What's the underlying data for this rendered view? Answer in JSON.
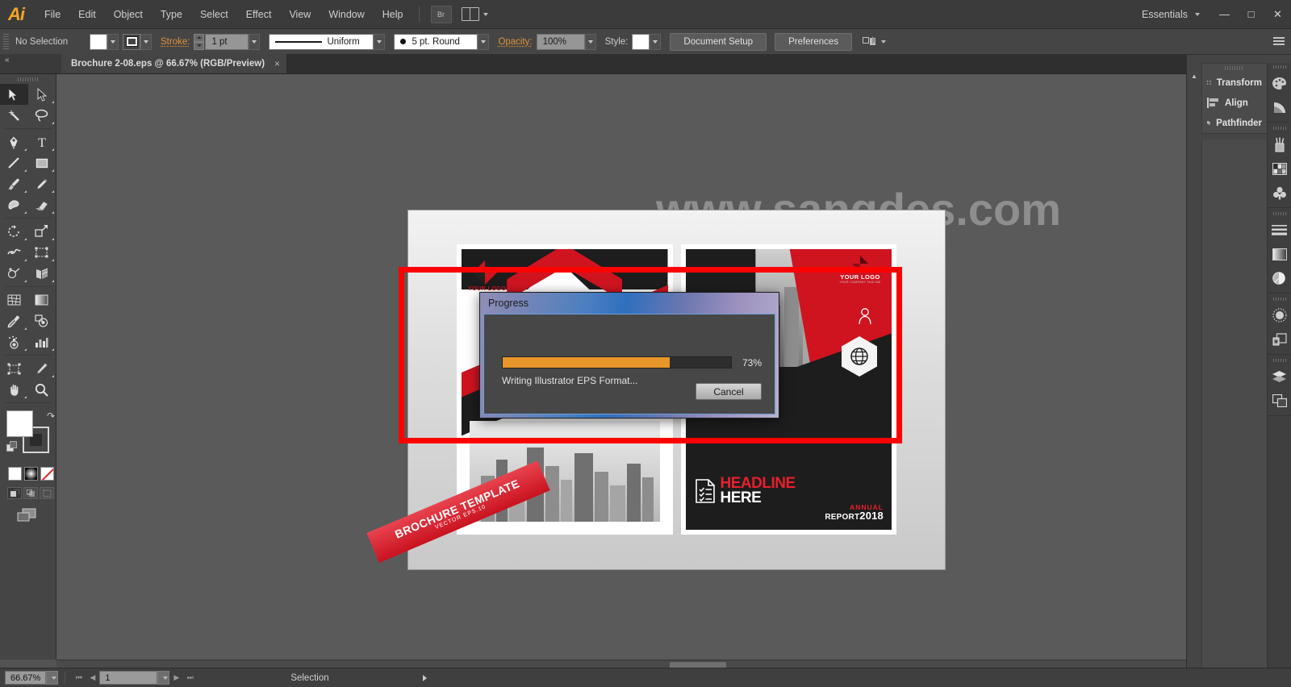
{
  "app": {
    "name": "Adobe Illustrator",
    "logo_text": "Ai"
  },
  "titlebar": {
    "menus": [
      "File",
      "Edit",
      "Object",
      "Type",
      "Select",
      "Effect",
      "View",
      "Window",
      "Help"
    ],
    "bridge_label": "Br",
    "arrange_label": "arrange-documents",
    "workspace": "Essentials",
    "window_buttons": {
      "minimize": "—",
      "maximize": "□",
      "close": "✕"
    }
  },
  "controlbar": {
    "selection_status": "No Selection",
    "fill_label": "Fill",
    "stroke_swatch_label": "Stroke color",
    "stroke_label": "Stroke:",
    "stroke_weight": "1 pt",
    "profile_label": "Uniform",
    "brush_label": "5 pt. Round",
    "opacity_label": "Opacity:",
    "opacity_value": "100%",
    "style_label": "Style:",
    "document_setup": "Document Setup",
    "preferences": "Preferences",
    "align_label": "align-to-selection"
  },
  "tabbar": {
    "document_tab": "Brochure 2-08.eps @ 66.67% (RGB/Preview)",
    "close_glyph": "×",
    "collapse_glyph": "«"
  },
  "toolbar": {
    "tools": [
      {
        "name": "selection-tool",
        "selected": true
      },
      {
        "name": "direct-selection-tool",
        "selected": false
      },
      {
        "name": "magic-wand-tool",
        "selected": false
      },
      {
        "name": "lasso-tool",
        "selected": false
      },
      {
        "name": "pen-tool",
        "selected": false
      },
      {
        "name": "type-tool",
        "selected": false
      },
      {
        "name": "line-segment-tool",
        "selected": false
      },
      {
        "name": "rectangle-tool",
        "selected": false
      },
      {
        "name": "paintbrush-tool",
        "selected": false
      },
      {
        "name": "pencil-tool",
        "selected": false
      },
      {
        "name": "blob-brush-tool",
        "selected": false
      },
      {
        "name": "eraser-tool",
        "selected": false
      },
      {
        "name": "rotate-tool",
        "selected": false
      },
      {
        "name": "scale-tool",
        "selected": false
      },
      {
        "name": "width-tool",
        "selected": false
      },
      {
        "name": "free-transform-tool",
        "selected": false
      },
      {
        "name": "shape-builder-tool",
        "selected": false
      },
      {
        "name": "perspective-grid-tool",
        "selected": false
      },
      {
        "name": "mesh-tool",
        "selected": false
      },
      {
        "name": "gradient-tool",
        "selected": false
      },
      {
        "name": "eyedropper-tool",
        "selected": false
      },
      {
        "name": "blend-tool",
        "selected": false
      },
      {
        "name": "symbol-sprayer-tool",
        "selected": false
      },
      {
        "name": "column-graph-tool",
        "selected": false
      },
      {
        "name": "artboard-tool",
        "selected": false
      },
      {
        "name": "slice-tool",
        "selected": false
      },
      {
        "name": "hand-tool",
        "selected": false
      },
      {
        "name": "zoom-tool",
        "selected": false
      }
    ],
    "fill_color": "#ffffff",
    "stroke_color": "#000000",
    "swap_label": "swap-fill-and-stroke",
    "default_label": "default-fill-and-stroke",
    "paint_modes": [
      "color",
      "gradient",
      "none"
    ],
    "draw_modes": [
      "draw-normal",
      "draw-behind",
      "draw-inside"
    ],
    "screen_mode": "change-screen-mode"
  },
  "canvas": {
    "watermark": "www.sangdes.com",
    "selection_rect_color": "#ff0000"
  },
  "artwork": {
    "left_panel": {
      "logo_text": "YOUR LOGO",
      "ribbon_line1": "BROCHURE TEMPLATE",
      "ribbon_line2": "VECTOR EPS.10"
    },
    "right_panel": {
      "logo_text": "YOUR LOGO",
      "logo_tagline": "YOUR COMPANY TAGLINE",
      "headline_line1": "HEADLINE",
      "headline_line2": "HERE",
      "annual_label": "ANNUAL",
      "report_label": "REPORT",
      "report_year": "2018"
    }
  },
  "dialog": {
    "title": "Progress",
    "progress_percent": "73%",
    "progress_value": 73,
    "message": "Writing Illustrator EPS Format...",
    "cancel_label": "Cancel",
    "bar_color": "#e8962b"
  },
  "right_panels": {
    "items": [
      {
        "label": "Transform",
        "icon": "transform-icon"
      },
      {
        "label": "Align",
        "icon": "align-icon"
      },
      {
        "label": "Pathfinder",
        "icon": "pathfinder-icon"
      }
    ],
    "rail_icons": [
      "color-icon",
      "color-guide-icon",
      "brushes-icon",
      "swatches-icon",
      "symbols-icon",
      "stroke-icon",
      "gradient-icon",
      "transparency-icon",
      "appearance-icon",
      "graphic-styles-icon",
      "layers-icon",
      "artboards-icon"
    ],
    "collapse_glyph": "▲"
  },
  "statusbar": {
    "zoom_level": "66.67%",
    "page_number": "1",
    "tool_status": "Selection",
    "first_page_glyph": "⏮",
    "prev_page_glyph": "◀",
    "next_page_glyph": "▶",
    "last_page_glyph": "⏭"
  }
}
